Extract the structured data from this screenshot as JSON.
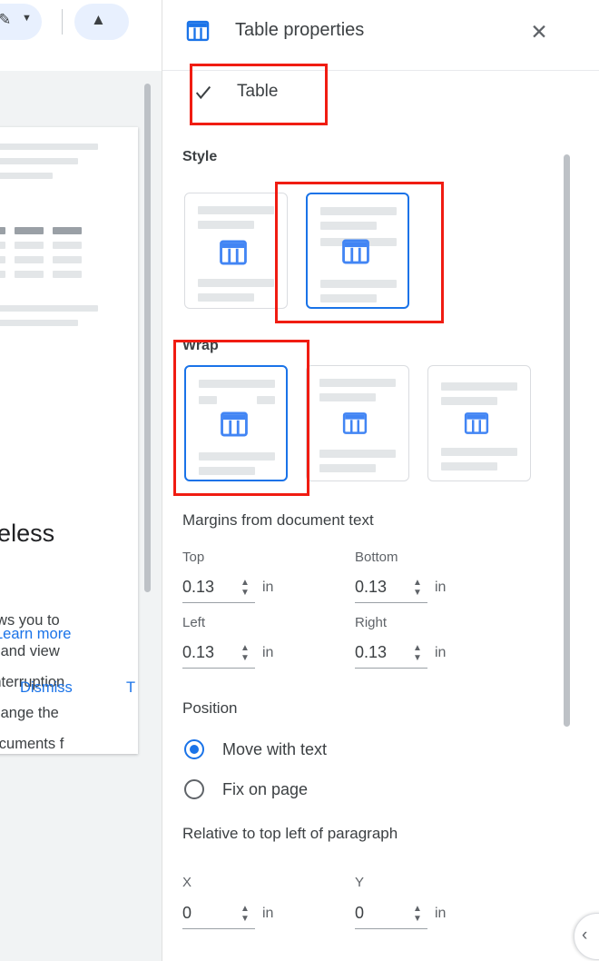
{
  "document": {
    "toolbar": {
      "pencil_icon": "pencil-icon",
      "caret_icon": "chevron-down-icon",
      "chevron_up_icon": "chevron-up-icon"
    },
    "heading": "pageless",
    "paragraph_lines": [
      "at allows you to",
      "ables, and view",
      "t the interruption",
      "can change the",
      "our documents f"
    ],
    "learn_more": "Learn more",
    "dismiss": "Dismiss",
    "trailing_letter": "T"
  },
  "panel": {
    "title": "Table properties",
    "title_icon": "table-icon",
    "close_icon": "close-icon",
    "section": {
      "label": "Table",
      "check_icon": "check-icon"
    },
    "style": {
      "label": "Style",
      "options": [
        {
          "name": "style-option-1",
          "selected": false
        },
        {
          "name": "style-option-2",
          "selected": true
        }
      ]
    },
    "wrap": {
      "label": "Wrap",
      "options": [
        {
          "name": "wrap-option-1",
          "selected": true
        },
        {
          "name": "wrap-option-2",
          "selected": false
        },
        {
          "name": "wrap-option-3",
          "selected": false
        }
      ]
    },
    "margins": {
      "label": "Margins from document text",
      "fields": [
        {
          "label": "Top",
          "value": "0.13",
          "unit": "in"
        },
        {
          "label": "Bottom",
          "value": "0.13",
          "unit": "in"
        },
        {
          "label": "Left",
          "value": "0.13",
          "unit": "in"
        },
        {
          "label": "Right",
          "value": "0.13",
          "unit": "in"
        }
      ]
    },
    "position": {
      "label": "Position",
      "options": [
        {
          "label": "Move with text",
          "selected": true
        },
        {
          "label": "Fix on page",
          "selected": false
        }
      ],
      "relative_label": "Relative to top left of paragraph",
      "coords": [
        {
          "label": "X",
          "value": "0",
          "unit": "in"
        },
        {
          "label": "Y",
          "value": "0",
          "unit": "in"
        }
      ]
    },
    "collapse_icon": "chevron-left-icon"
  },
  "colors": {
    "accent": "#1a73e8",
    "annotation": "#f01c12",
    "text": "#3c4043"
  }
}
